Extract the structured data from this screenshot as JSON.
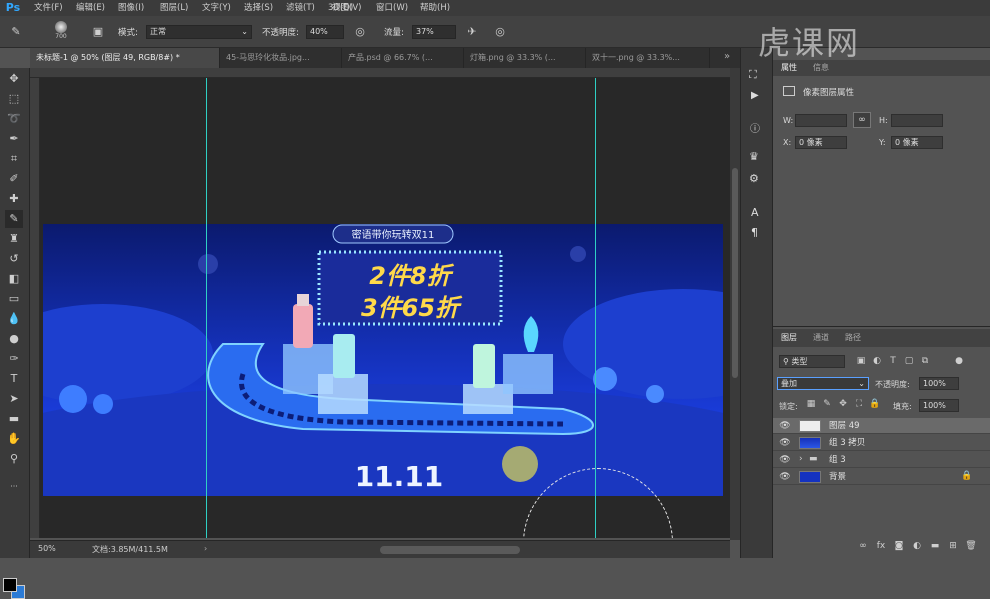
{
  "app": {
    "logo": "Ps"
  },
  "menu": [
    "文件(F)",
    "编辑(E)",
    "图像(I)",
    "图层(L)",
    "文字(Y)",
    "选择(S)",
    "滤镜(T)",
    "3D(D)",
    "视图(V)",
    "窗口(W)",
    "帮助(H)"
  ],
  "options": {
    "brush_size": "700",
    "mode_label": "模式:",
    "mode_value": "正常",
    "opacity_label": "不透明度:",
    "opacity_value": "40%",
    "flow_label": "流量:",
    "flow_value": "37%"
  },
  "tabs": [
    {
      "label": "未标题-1 @ 50% (图层 49, RGB/8#) *"
    },
    {
      "label": "45-马思玲化妆品.jpg..."
    },
    {
      "label": "产品.psd @ 66.7% (..."
    },
    {
      "label": "灯箱.png @ 33.3% (..."
    },
    {
      "label": "双十一.png @ 33.3%..."
    }
  ],
  "artwork": {
    "header_text": "密语带你玩转双11",
    "line1": "2件8折",
    "line2": "3件65折",
    "bottom": "11.11"
  },
  "status": {
    "zoom": "50%",
    "doc": "文档:3.85M/411.5M"
  },
  "properties": {
    "tab1": "属性",
    "tab2": "信息",
    "title": "像素图层属性",
    "w_label": "W:",
    "h_label": "H:",
    "x_label": "X:",
    "x_value": "0 像素",
    "y_label": "Y:",
    "y_value": "0 像素"
  },
  "layers_panel": {
    "tabs": [
      "图层",
      "通道",
      "路径"
    ],
    "filter_label": "类型",
    "blend_mode": "叠加",
    "opacity_label": "不透明度:",
    "opacity_value": "100%",
    "lock_label": "锁定:",
    "fill_label": "填充:",
    "fill_value": "100%",
    "layers": [
      {
        "name": "图层 49",
        "selected": true
      },
      {
        "name": "组 3 拷贝",
        "selected": false
      },
      {
        "name": "组 3",
        "selected": false
      },
      {
        "name": "背景",
        "selected": false
      }
    ]
  },
  "watermark": "虎课网",
  "colors": {
    "accent": "#31a8ff",
    "guide": "#2fd0c4",
    "foreground": "#000000",
    "background": "#2b7bd6"
  }
}
